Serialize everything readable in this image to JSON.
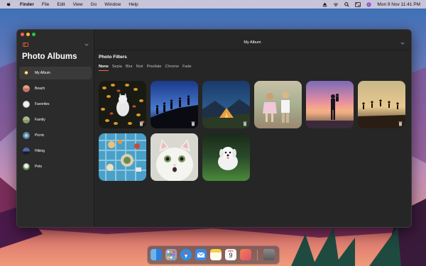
{
  "menubar": {
    "app": "Finder",
    "items": [
      "File",
      "Edit",
      "View",
      "Go",
      "Window",
      "Help"
    ],
    "datetime": "Mon 9 Nov  11:41 PM",
    "status_icons": [
      "eject-icon",
      "wifi-icon",
      "search-icon",
      "control-center-icon",
      "siri-icon"
    ]
  },
  "window": {
    "title": "My Album"
  },
  "sidebar": {
    "title": "Photo Albums",
    "items": [
      {
        "label": "My Album",
        "active": true,
        "color": "#5a4a2a"
      },
      {
        "label": "Beach",
        "active": false,
        "color": "#c88a5a"
      },
      {
        "label": "Favorites",
        "active": false,
        "color": "#d8d8d8"
      },
      {
        "label": "Family",
        "active": false,
        "color": "#9aa07a"
      },
      {
        "label": "Picnic",
        "active": false,
        "color": "#6aa0c0"
      },
      {
        "label": "Hiking",
        "active": false,
        "color": "#2a3a6a"
      },
      {
        "label": "Pets",
        "active": false,
        "color": "#8a9a8a"
      }
    ]
  },
  "main": {
    "section_title": "Photo Filters",
    "filters": [
      "None",
      "Sepia",
      "Blur",
      "Noir",
      "Pixellate",
      "Chrome",
      "Fade"
    ],
    "active_filter": "None",
    "photos": [
      {
        "name": "cat-in-leaves",
        "has_delete": true
      },
      {
        "name": "hikers-silhouette",
        "has_delete": true
      },
      {
        "name": "camping-tent",
        "has_delete": true
      },
      {
        "name": "kids-walking",
        "has_delete": false
      },
      {
        "name": "beach-sunset-family",
        "has_delete": false
      },
      {
        "name": "jumping-silhouettes",
        "has_delete": true
      },
      {
        "name": "picnic-blanket",
        "has_delete": false
      },
      {
        "name": "surprised-kitten",
        "has_delete": false
      },
      {
        "name": "running-dog",
        "has_delete": false
      }
    ]
  },
  "dock": {
    "apps": [
      "finder-icon",
      "launchpad-icon",
      "safari-icon",
      "mail-icon",
      "notes-icon",
      "calendar-icon",
      "photos-icon",
      "trash-icon"
    ],
    "calendar_month": "NOV",
    "calendar_day": "9"
  },
  "colors": {
    "accent": "#ff6a3d",
    "window_bg": "#262626",
    "sidebar_bg": "#2b2b2b"
  }
}
